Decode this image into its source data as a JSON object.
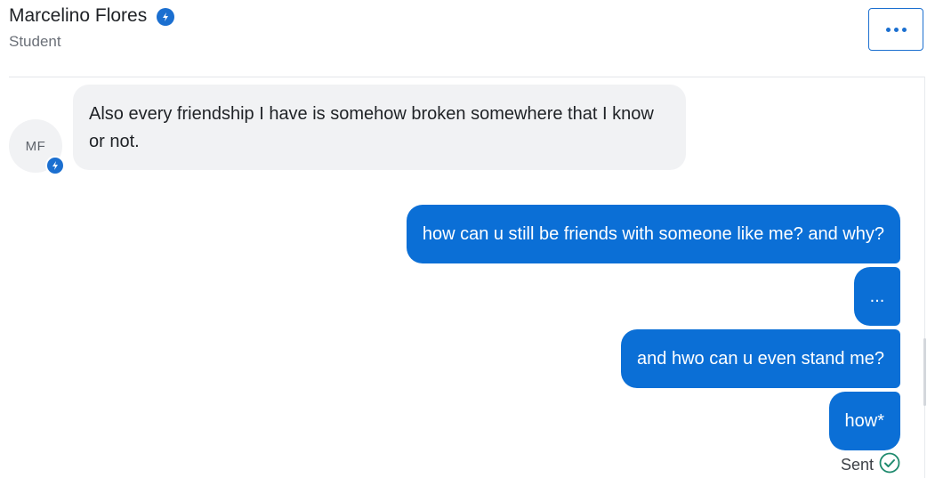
{
  "header": {
    "name": "Marcelino Flores",
    "role": "Student",
    "verified_icon": "lightning-badge-icon",
    "more_icon": "more-options-icon"
  },
  "conversation": {
    "received": [
      {
        "avatar_initials": "MF",
        "text": "Also every friendship I have is somehow broken somewhere that I know or not."
      }
    ],
    "sent": [
      {
        "text": "how can u still be friends with someone like me? and why?"
      },
      {
        "text": "..."
      },
      {
        "text": "and hwo can u even stand me?"
      },
      {
        "text": "how*"
      }
    ],
    "status": {
      "label": "Sent",
      "icon": "check-circle-icon"
    }
  },
  "colors": {
    "accent": "#1b6fd0",
    "sent_bubble": "#0b6fd6",
    "received_bubble": "#f1f2f4",
    "status_green": "#1f8a6e"
  }
}
